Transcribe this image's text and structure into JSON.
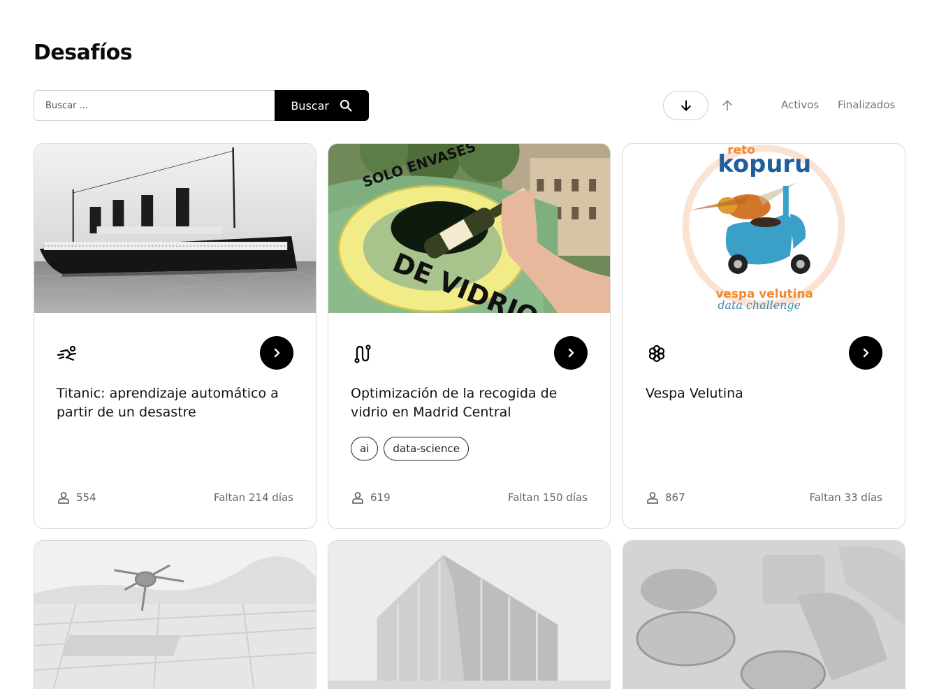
{
  "page": {
    "title": "Desafíos"
  },
  "search": {
    "placeholder": "Buscar ...",
    "button_label": "Buscar"
  },
  "filters": {
    "active_label": "Activos",
    "finished_label": "Finalizados"
  },
  "cards": [
    {
      "title": "Titanic: aprendizaje automático a partir de un desastre",
      "icon": "swimmer-icon",
      "tags": [],
      "participants": "554",
      "remaining": "Faltan 214 días"
    },
    {
      "title": "Optimización de la recogida de vidrio en Madrid Central",
      "icon": "route-icon",
      "tags": [
        "ai",
        "data-science"
      ],
      "participants": "619",
      "remaining": "Faltan 150 días"
    },
    {
      "title": "Vespa Velutina",
      "icon": "flower-icon",
      "tags": [],
      "participants": "867",
      "remaining": "Faltan 33 días"
    }
  ],
  "kopuru_logo": {
    "top": "reto",
    "main": "kopuru",
    "sub1": "vespa velutina",
    "sub2": "data challenge"
  },
  "glass_container_text": {
    "top": "SOLO ENVASES",
    "bottom": "DE VIDRIO"
  },
  "colors": {
    "primary": "#000000",
    "muted": "#777777",
    "border": "#d8d8d8"
  }
}
